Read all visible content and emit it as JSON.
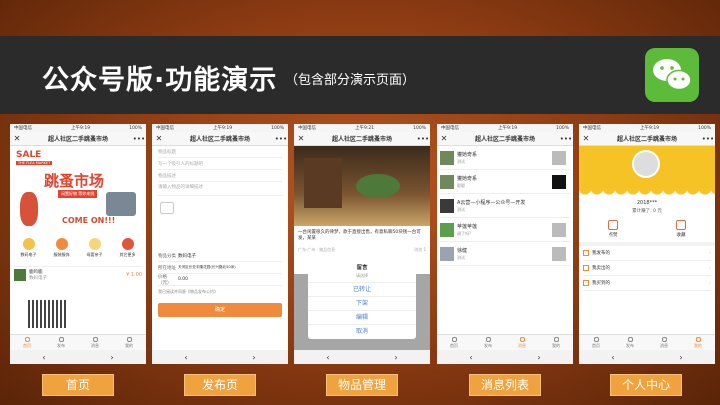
{
  "banner": {
    "title": "公众号版·功能演示",
    "subtitle": "（包含部分演示页面）"
  },
  "status": {
    "carrier": "中国电信",
    "time": "上午9:19",
    "time_alt": "上午9:21",
    "battery": "100%"
  },
  "nav": {
    "title": "超人社区二手跳蚤市场",
    "close": "✕",
    "more": "•••"
  },
  "tabs": [
    "首页",
    "发布",
    "消息",
    "我的"
  ],
  "back_icons": [
    "‹",
    "›"
  ],
  "home": {
    "sale": "SALE",
    "sale_sub": "THE FLEA MARKET",
    "hero_title": "跳蚤市场",
    "hero_tag": "闲置好物 等你来挑",
    "hero_come": "COME ON!!!",
    "categories": [
      "数码电子",
      "服装服饰",
      "母婴亲子",
      "其它更多"
    ],
    "item": {
      "name": "鹿鸣鹿",
      "sub": "数码电子",
      "price": "¥ 1.00"
    }
  },
  "publish": {
    "title_placeholder": "物品标题",
    "title_hint": "写一个吸引人的标题吧",
    "desc_label": "物品描述",
    "desc_placeholder": "请输入物品的详细描述",
    "rows": [
      {
        "k": "物品分类",
        "v": "数码电子"
      },
      {
        "k": "所在地址",
        "v": "天河区长亚丰隆花园(长兴路北50米)"
      },
      {
        "k": "价格（元）",
        "v": "0.00"
      }
    ],
    "agree": "我已阅读并同意《物品发布公约》",
    "submit": "确定"
  },
  "manage": {
    "desc": "一台闲置很久的律梦，款于直接出售，有意私聊50块钱一台可发，某某",
    "meta": "广东·广州 · 物品信息",
    "meta_right": "浏览 1",
    "sheet_title": "留言",
    "sheet_sub": "请选择",
    "options": [
      "已转让",
      "下架",
      "编辑"
    ],
    "cancel": "取消"
  },
  "messages": [
    {
      "title": "獾她奇系",
      "sub": "测试",
      "avatar_color": "#6f8a5a"
    },
    {
      "title": "獾她奇系",
      "sub": "聪聪",
      "avatar_color": "#6f8a5a"
    },
    {
      "title": "A云营—小程序—公众号—开发",
      "sub": "测试",
      "avatar_color": "#3a3a3a"
    },
    {
      "title": "苹莲苹莲",
      "sub": "谢了吗?",
      "avatar_color": "#5aa04a"
    },
    {
      "title": "徐健",
      "sub": "测试",
      "avatar_color": "#9aa4ae"
    }
  ],
  "profile": {
    "name": "2018***",
    "earn": "累计赚了: 0 元",
    "stats": [
      "点赞",
      "收藏"
    ],
    "rows": [
      "我发布的",
      "我卖出的",
      "我买到的"
    ]
  },
  "labels": [
    "首页",
    "发布页",
    "物品管理",
    "消息列表",
    "个人中心"
  ],
  "colors": {
    "accent": "#f08a3c",
    "banner": "#2b2b2b",
    "wechat": "#5dbb3a",
    "label_bg": "#f0a23e"
  }
}
